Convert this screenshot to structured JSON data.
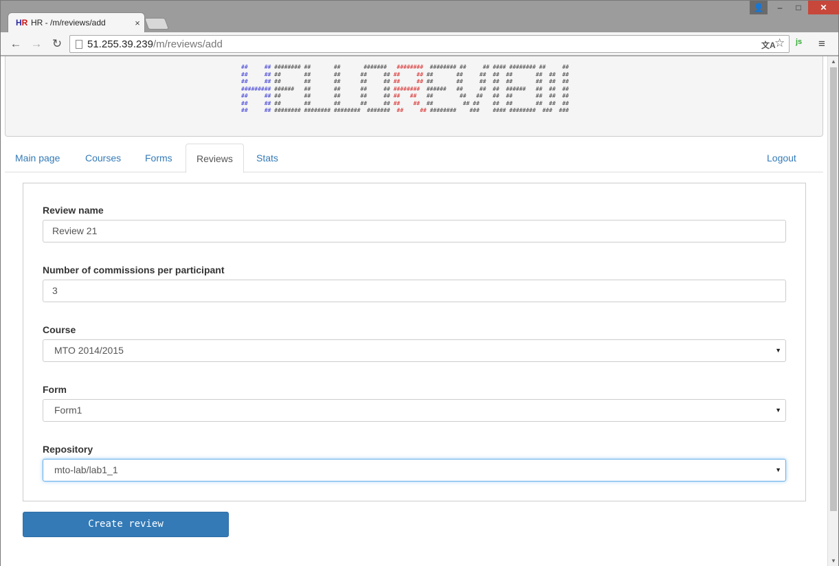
{
  "browser": {
    "tab_title": "HR - /m/reviews/add",
    "tab_close": "×",
    "favicon": {
      "h": "H",
      "r": "R"
    },
    "url_host": "51.255.39.239",
    "url_path": "/m/reviews/add",
    "window_buttons": {
      "user": "👤",
      "minimize": "–",
      "maximize": "□",
      "close": "✕"
    },
    "nav_icons": {
      "back": "←",
      "forward": "→",
      "reload": "↻"
    },
    "extension_label": "js",
    "translate_label": "文A",
    "star_icon": "☆",
    "menu_icon": "≡"
  },
  "banner": {
    "ascii_lines": [
      [
        "##     ## ",
        "",
        "######## ##       ##       #######   ",
        "########",
        "  ######## ##     ## #### ######## ##     ##"
      ],
      [
        "##     ## ",
        "",
        "##       ##       ##      ##     ## ",
        "##     ##",
        " ##       ##     ##  ##  ##       ##  ##  ##"
      ],
      [
        "##     ## ",
        "",
        "##       ##       ##      ##     ## ",
        "##     ##",
        " ##       ##     ##  ##  ##       ##  ##  ##"
      ],
      [
        "######### ",
        "",
        "######   ##       ##      ##     ## ",
        "########",
        "  ######   ##     ##  ##  ######   ##  ##  ##"
      ],
      [
        "##     ## ",
        "",
        "##       ##       ##      ##     ## ",
        "##   ##",
        "   ##        ##   ##   ##  ##       ##  ##  ##"
      ],
      [
        "##     ## ",
        "",
        "##       ##       ##      ##     ## ",
        "##    ##",
        "  ##         ## ##    ##  ##       ##  ##  ##"
      ],
      [
        "##     ## ",
        "",
        "######## ######## ########  #######  ",
        "##     ##",
        " ########    ###    #### ########  ###  ###"
      ]
    ]
  },
  "nav": {
    "tabs": [
      "Main page",
      "Courses",
      "Forms",
      "Reviews",
      "Stats"
    ],
    "active": "Reviews",
    "logout": "Logout"
  },
  "form": {
    "review_name": {
      "label": "Review name",
      "value": "Review 21"
    },
    "commissions": {
      "label": "Number of commissions per participant",
      "value": "3"
    },
    "course": {
      "label": "Course",
      "value": "MTO 2014/2015"
    },
    "form": {
      "label": "Form",
      "value": "Form1"
    },
    "repository": {
      "label": "Repository",
      "value": "mto-lab/lab1_1"
    },
    "caret": "▼",
    "submit_label": "Create review"
  },
  "colors": {
    "primary": "#337ab7",
    "link": "#337ab7",
    "close_button": "#c7473a",
    "ascii_blue": "#3b3bd8",
    "ascii_red": "#d82a2a"
  }
}
